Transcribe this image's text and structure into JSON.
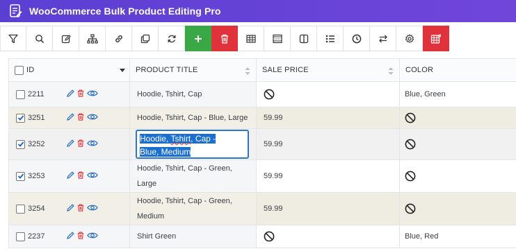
{
  "app": {
    "title": "WooCommerce Bulk Product Editing Pro"
  },
  "toolbar": {
    "buttons": [
      {
        "icon": "filter-icon"
      },
      {
        "icon": "search-icon"
      },
      {
        "icon": "edit-icon"
      },
      {
        "icon": "hierarchy-icon"
      },
      {
        "icon": "link-icon"
      },
      {
        "icon": "duplicate-icon"
      },
      {
        "icon": "refresh-icon"
      },
      {
        "icon": "plus-icon"
      },
      {
        "icon": "trash-icon"
      },
      {
        "icon": "table-icon"
      },
      {
        "icon": "layout-icon"
      },
      {
        "icon": "columns-icon"
      },
      {
        "icon": "list-icon"
      },
      {
        "icon": "history-icon"
      },
      {
        "icon": "swap-icon"
      },
      {
        "icon": "settings-icon"
      },
      {
        "icon": "bulk-edit-icon"
      }
    ]
  },
  "table": {
    "headers": {
      "id": "ID",
      "title": "PRODUCT TITLE",
      "sale_price": "SALE PRICE",
      "color": "COLOR"
    },
    "rows": [
      {
        "id": "2211",
        "checked": false,
        "title": "Hoodie, Tshirt, Cap",
        "sale_price": "",
        "color": "Blue, Green",
        "style": "white"
      },
      {
        "id": "3251",
        "checked": true,
        "title": "Hoodie, Tshirt, Cap - Blue, Large",
        "sale_price": "59.99",
        "color": "",
        "style": "beige"
      },
      {
        "id": "3252",
        "checked": true,
        "title": "Hoodie, Tshirt, Cap - Blue, Medium",
        "sale_price": "59.99",
        "color": "",
        "style": "grey",
        "editing": true
      },
      {
        "id": "3253",
        "checked": true,
        "title_line1": "Hoodie, Tshirt, Cap - Green,",
        "title_line2": "Large",
        "sale_price": "59.99",
        "color": "",
        "style": "white"
      },
      {
        "id": "3254",
        "checked": false,
        "title_line1": "Hoodie, Tshirt, Cap - Green,",
        "title_line2": "Medium",
        "sale_price": "59.99",
        "color": "",
        "style": "beige"
      },
      {
        "id": "2237",
        "checked": false,
        "title": "Shirt Green",
        "sale_price": "",
        "color": "Blue, Red",
        "style": "white"
      }
    ],
    "editor": {
      "part1": "Hoodie, ",
      "part2": "Tshirt",
      "part3": ", Cap -",
      "line2": "Blue, Medium"
    }
  },
  "colors": {
    "header_gradient_start": "#5b3fd3",
    "add_button": "#39a845",
    "delete_button": "#e0323b",
    "selected_row": "#efece1",
    "action_blue": "#2f74c7",
    "action_red": "#e0323b"
  }
}
